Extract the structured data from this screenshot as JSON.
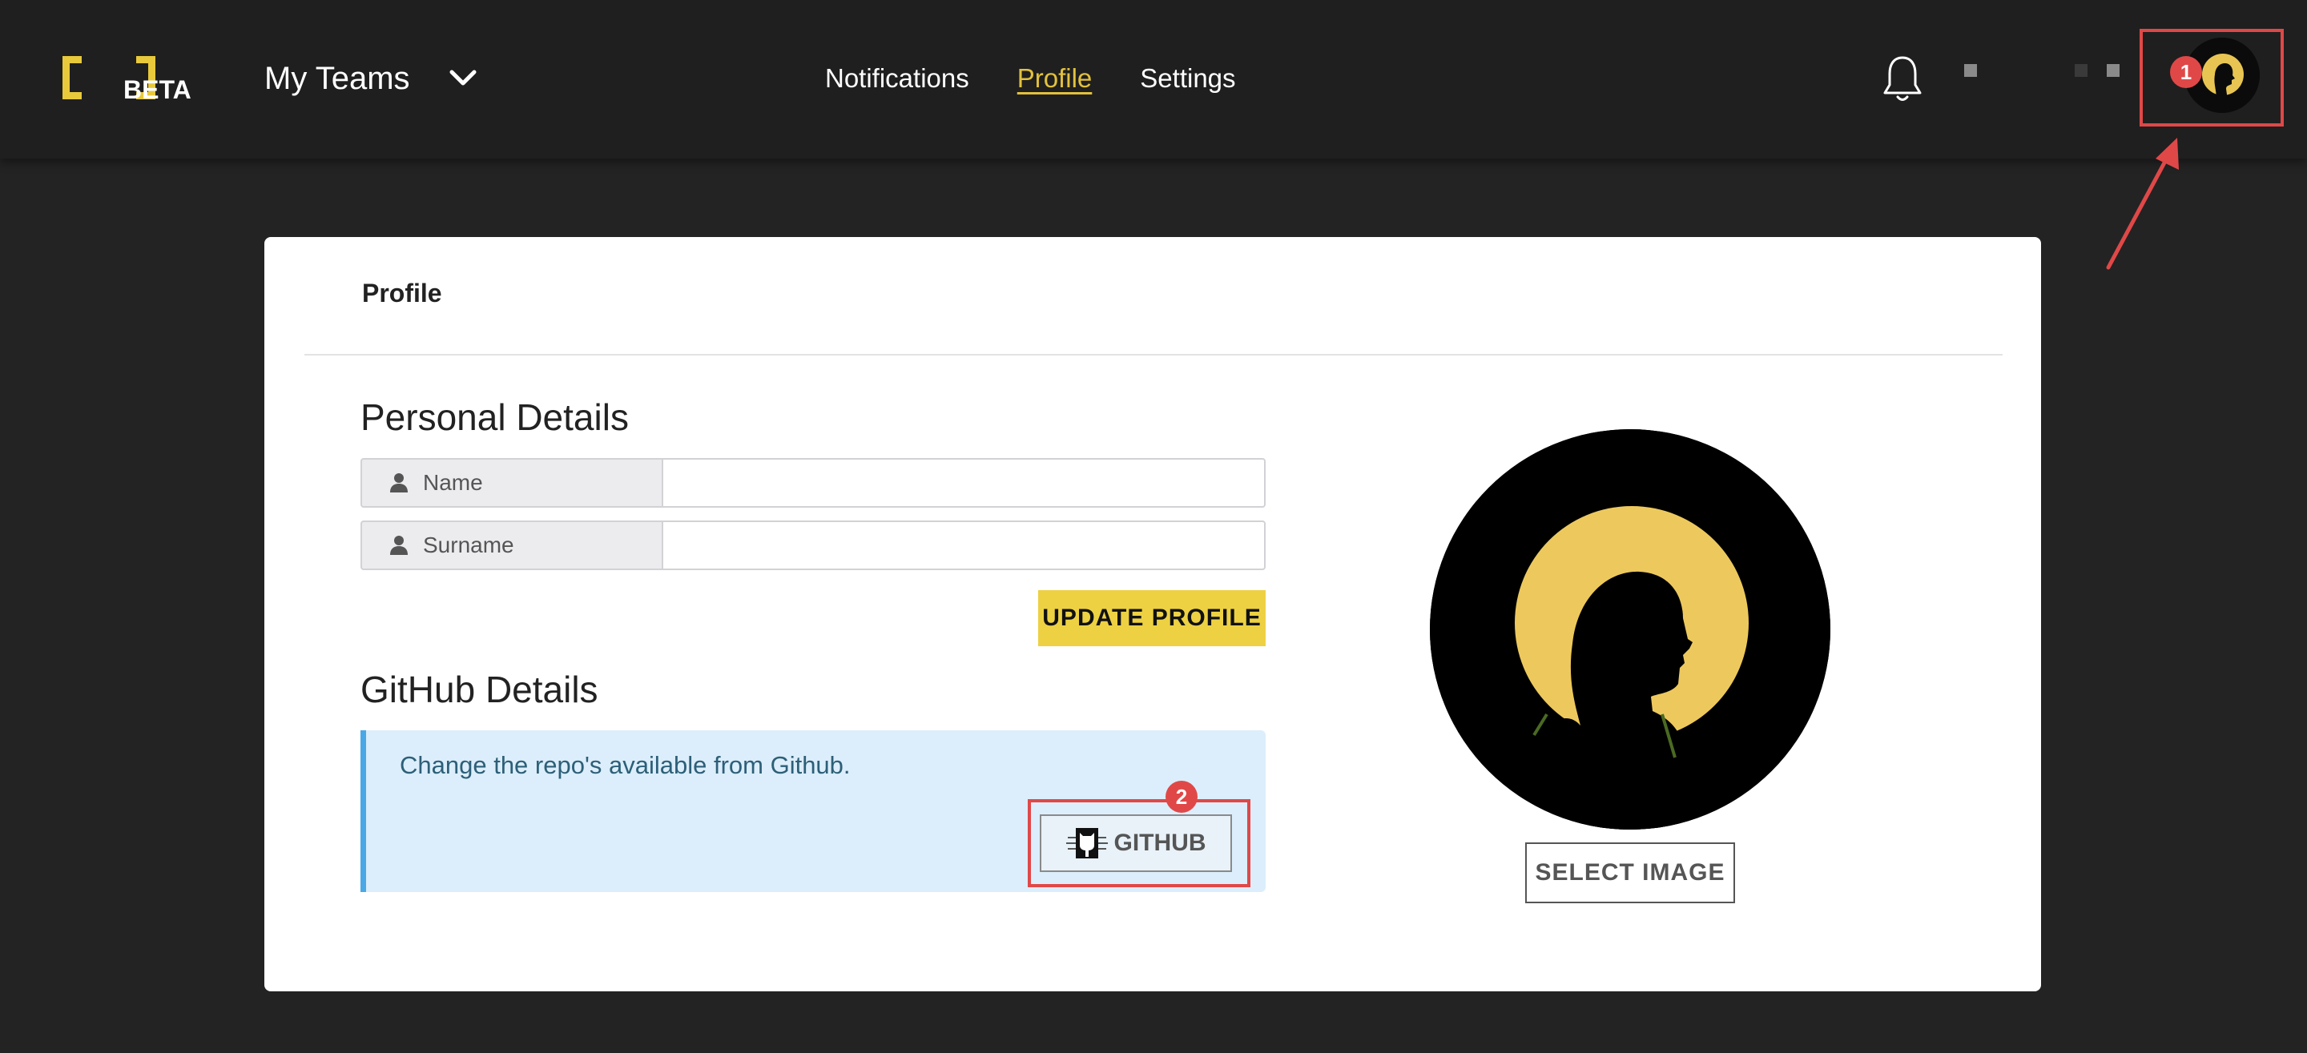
{
  "header": {
    "logo_text": "BETA",
    "team_selector": "My Teams",
    "nav": [
      {
        "label": "Notifications"
      },
      {
        "label": "Profile"
      },
      {
        "label": "Settings"
      }
    ],
    "active_nav": "Profile"
  },
  "annotations": {
    "step1": "1",
    "step2": "2",
    "highlight_color": "#e04848"
  },
  "card": {
    "title": "Profile",
    "personal": {
      "heading": "Personal Details",
      "name_label": "Name",
      "name_value": "",
      "surname_label": "Surname",
      "surname_value": "",
      "update_button": "UPDATE PROFILE"
    },
    "github": {
      "heading": "GitHub Details",
      "info_text": "Change the repo's available from Github.",
      "button": "GITHUB"
    },
    "photo": {
      "select_button": "SELECT IMAGE"
    }
  },
  "colors": {
    "accent_yellow": "#edd142",
    "nav_active": "#e2c13d",
    "info_bg": "#dceefb",
    "info_border": "#4aa8e6"
  }
}
